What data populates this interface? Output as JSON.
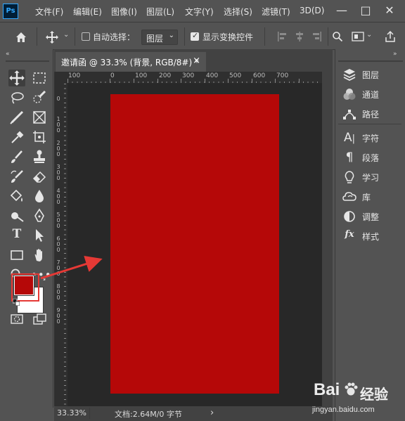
{
  "app": {
    "logo_text": "Ps"
  },
  "menu": [
    "文件(F)",
    "编辑(E)",
    "图像(I)",
    "图层(L)",
    "文字(Y)",
    "选择(S)",
    "滤镜(T)",
    "3D(D)"
  ],
  "window_controls": {
    "minimize": "—",
    "restore": "□",
    "close": "✕"
  },
  "options_bar": {
    "auto_select_label": "自动选择：",
    "auto_select_checked": false,
    "layer_select_value": "图层",
    "show_transform_label": "显示变换控件",
    "show_transform_checked": true
  },
  "document": {
    "tab_title": "邀请函 @ 33.3% (背景, RGB/8#) *",
    "close_glyph": "×",
    "ruler_h_labels": [
      "100",
      "0",
      "100",
      "200",
      "300",
      "400",
      "500",
      "600",
      "700"
    ],
    "ruler_v_labels": [
      "0",
      "1 0 0",
      "2 0 0",
      "3 0 0",
      "4 0 0",
      "5 0 0",
      "6 0 0",
      "7 0 0",
      "8 0 0",
      "9 0 0"
    ],
    "canvas_fill_color": "#b50808",
    "background_color": "#282828"
  },
  "status_bar": {
    "zoom": "33.33%",
    "doc_info": "文档:2.64M/0 字节",
    "arrow": "›"
  },
  "colors": {
    "foreground": "#b50808",
    "background": "#ffffff",
    "annotation": "#e53935"
  },
  "tools": [
    "move",
    "marquee",
    "lasso",
    "quick-select",
    "brush-healing",
    "crop",
    "eyedropper",
    "frame",
    "brush",
    "stamp",
    "history-brush",
    "eraser",
    "paint-bucket",
    "blur",
    "dodge",
    "pen",
    "type",
    "path-select",
    "rectangle",
    "hand",
    "zoom",
    "more-tools"
  ],
  "right_panel": [
    {
      "icon": "layers-icon",
      "label": "图层"
    },
    {
      "icon": "channels-icon",
      "label": "通道"
    },
    {
      "icon": "paths-icon",
      "label": "路径"
    },
    {
      "icon": "character-icon",
      "label": "字符"
    },
    {
      "icon": "paragraph-icon",
      "label": "段落"
    },
    {
      "icon": "learn-icon",
      "label": "学习"
    },
    {
      "icon": "libraries-icon",
      "label": "库"
    },
    {
      "icon": "adjustments-icon",
      "label": "调整"
    },
    {
      "icon": "styles-icon",
      "label": "样式"
    }
  ],
  "watermark": {
    "brand": "Bai",
    "brand2": "经验",
    "url": "jingyan.baidu.com"
  }
}
